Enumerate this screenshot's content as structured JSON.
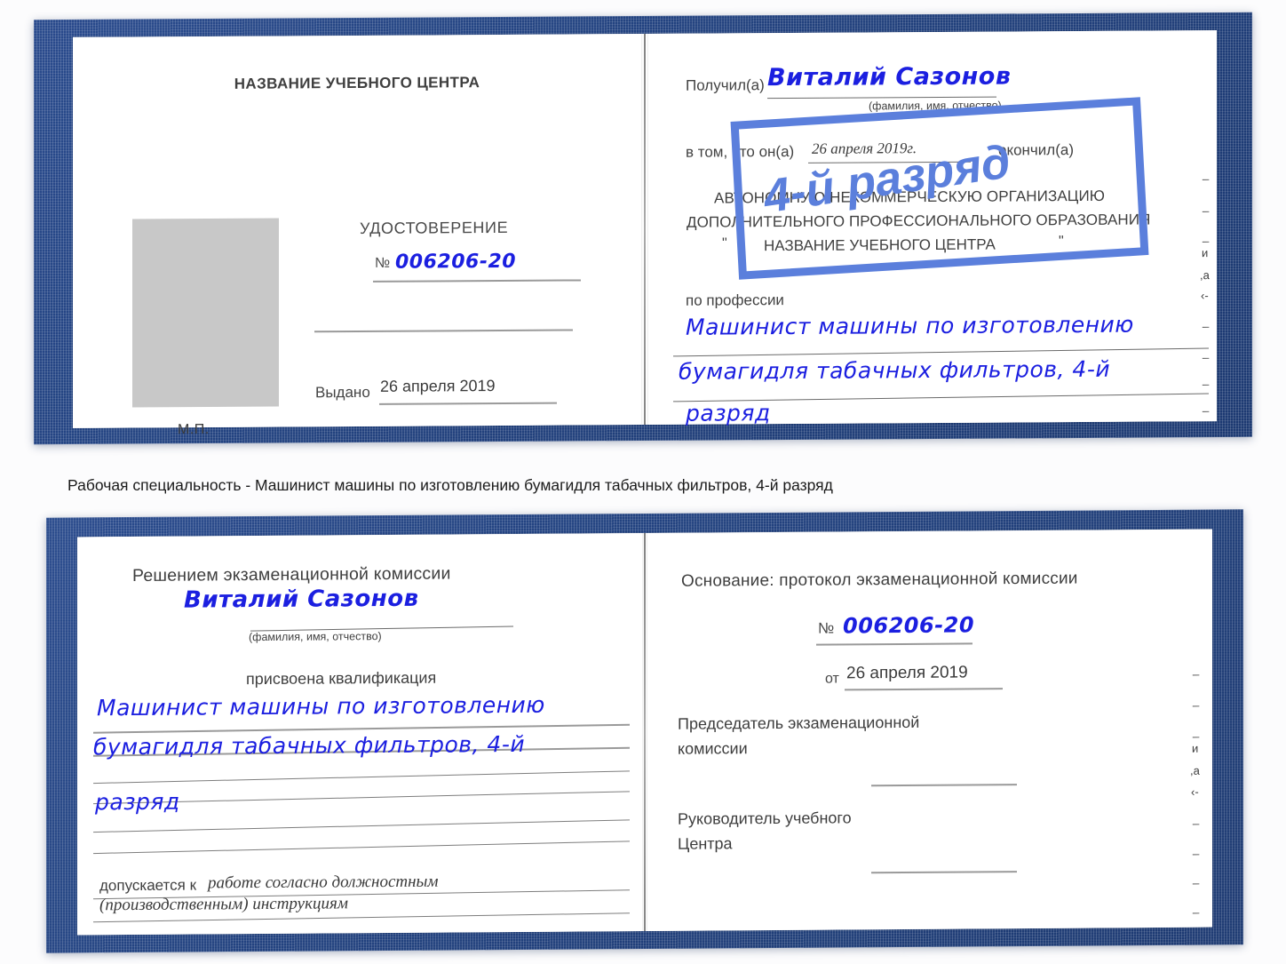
{
  "caption": {
    "text": "Рабочая специальность - Машинист машины по изготовлению бумагидля табачных фильтров, 4-й разряд"
  },
  "document": {
    "name": "Виталий Сазонов",
    "number": "006206-20",
    "date_issued": "26 апреля 2019",
    "date_completed": "26 апреля 2019г.",
    "qualification_line1": "Машинист машины по изготовлению",
    "qualification_line2": "бумагидля табачных фильтров, 4-й",
    "qualification_line3": "разряд",
    "grade_stamp": "4-й разряд"
  },
  "book1": {
    "left_page": {
      "center_name": "НАЗВАНИЕ УЧЕБНОГО ЦЕНТРА",
      "title": "УДОСТОВЕРЕНИЕ",
      "number_prefix": "№",
      "number_value": "006206-20",
      "issued_label": "Выдано",
      "issued_value": "26 апреля 2019",
      "seal_label": "М.П.",
      "photo_placeholder": "photo-placeholder"
    },
    "right_page": {
      "received_label": "Получил(а)",
      "received_value": "Виталий Сазонов",
      "fio_hint": "(фамилия, имя, отчество)",
      "in_that_label": "в том, что он(а)",
      "completion_date": "26 апреля 2019г.",
      "finished_label": "окончил(а)",
      "org_line1": "АВТОНОМНУЮ НЕКОММЕРЧЕСКУЮ ОРГАНИЗАЦИЮ",
      "org_line2": "ДОПОЛНИТЕЛЬНОГО ПРОФЕССИОНАЛЬНОГО ОБРАЗОВАНИЯ",
      "org_quote_open": "\"",
      "org_name": "НАЗВАНИЕ УЧЕБНОГО ЦЕНТРА",
      "org_quote_close": "\"",
      "profession_label": "по профессии",
      "profession_line1": "Машинист машины по изготовлению",
      "profession_line2": "бумагидля табачных фильтров, 4-й",
      "profession_line3": "разряд",
      "stamp_text": "4-й разряд",
      "edge_marks": [
        "_",
        "_",
        "_",
        "и",
        ",а",
        "‹-",
        "_",
        "_",
        "_",
        "_"
      ]
    }
  },
  "book2": {
    "left_page": {
      "heading": "Решением экзаменационной комиссии",
      "name": "Виталий Сазонов",
      "fio_hint": "(фамилия, имя, отчество)",
      "assigned_label": "присвоена квалификация",
      "qual_line1": "Машинист машины по изготовлению",
      "qual_line2": "бумагидля табачных фильтров, 4-й",
      "qual_line3": "разряд",
      "admitted_label": "допускается к",
      "admitted_value_line1": "работе согласно должностным",
      "admitted_value_line2": "(производственным) инструкциям"
    },
    "right_page": {
      "basis_label": "Основание: протокол экзаменационной комиссии",
      "number_prefix": "№",
      "number_value": "006206-20",
      "from_label": "от",
      "from_value": "26 апреля 2019",
      "chairman_line1": "Председатель экзаменационной",
      "chairman_line2": "комиссии",
      "head_line1": "Руководитель учебного",
      "head_line2": "Центра",
      "edge_marks": [
        "_",
        "_",
        "_",
        "и",
        ",а",
        "‹-",
        "_",
        "_",
        "_",
        "_"
      ]
    }
  },
  "colors": {
    "cover_blue": "#22427f",
    "ink_blue": "#1b1fe0",
    "stamp_blue": "#5b7fdc",
    "rule_gray": "#9a9a9a",
    "photo_gray": "#c8c8c8"
  }
}
